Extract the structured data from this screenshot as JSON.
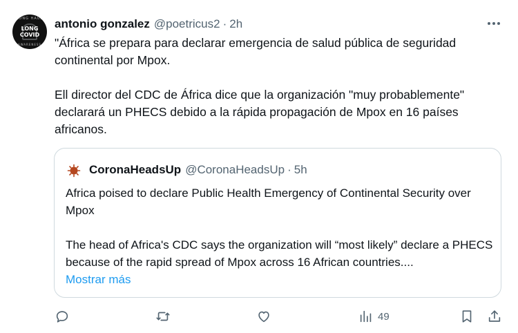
{
  "tweet": {
    "author_name": "antonio gonzalez",
    "author_handle": "@poetricus2",
    "separator": "·",
    "time": "2h",
    "avatar_text": {
      "top": "LONG HAUL",
      "line1": "LONG",
      "line2": "COVID",
      "bottom": "AWARENESS"
    },
    "paragraph1": "\"África se prepara para declarar emergencia de salud pública de seguridad continental por Mpox.",
    "paragraph2": "Ell director del CDC de África dice que la organización \"muy probablemente\" declarará un PHECS debido a la rápida propagación de Mpox en 16 países africanos."
  },
  "quote": {
    "author_name": "CoronaHeadsUp",
    "author_handle": "@CoronaHeadsUp",
    "separator": "·",
    "time": "5h",
    "paragraph1": "Africa poised to declare Public Health Emergency of Continental Security over Mpox",
    "paragraph2": "The head of Africa's CDC says the organization will “most likely” declare a PHECS because of the rapid spread of Mpox across 16 African countries....",
    "show_more": "Mostrar más"
  },
  "actions": {
    "views": "49",
    "icons": [
      "reply-icon",
      "retweet-icon",
      "like-icon",
      "views-icon",
      "bookmark-icon",
      "share-icon"
    ]
  },
  "colors": {
    "text": "#0f1419",
    "secondary": "#536471",
    "link": "#1d9bf0",
    "border": "#cfd9de",
    "quote_avatar": "#b5471f"
  }
}
